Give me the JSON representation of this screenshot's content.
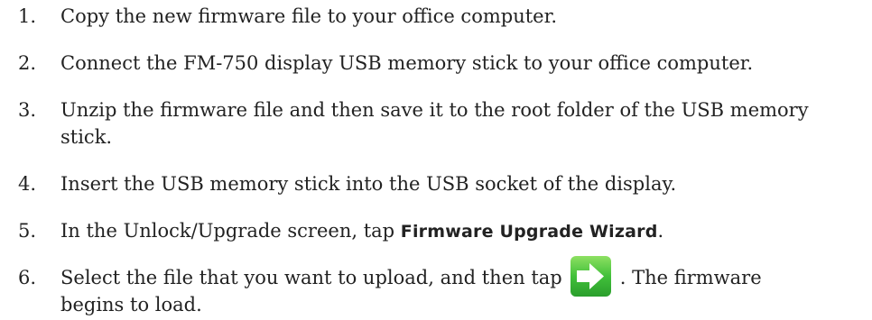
{
  "steps": [
    {
      "num": "1.",
      "text": "Copy the new firmware file to your office computer."
    },
    {
      "num": "2.",
      "text": "Connect the FM-750 display USB memory stick to your office computer."
    },
    {
      "num": "3.",
      "line1": "Unzip the firmware file and then save it to the root folder of the USB memory",
      "line2": "stick."
    },
    {
      "num": "4.",
      "text": "Insert the USB memory stick into the USB socket of the display."
    },
    {
      "num": "5.",
      "before": "In the Unlock/Upgrade screen, tap ",
      "bold": "Firmware Upgrade Wizard",
      "after": "."
    },
    {
      "num": "6.",
      "before": "Select the file that you want to upload, and then tap",
      "after": ". The firmware",
      "line2": "begins to load.",
      "icon": "next-arrow-icon"
    }
  ],
  "colors": {
    "text": "#222222",
    "icon_green": "#3cb93a",
    "icon_green_light": "#7fdc5a",
    "icon_arrow": "#ffffff"
  }
}
